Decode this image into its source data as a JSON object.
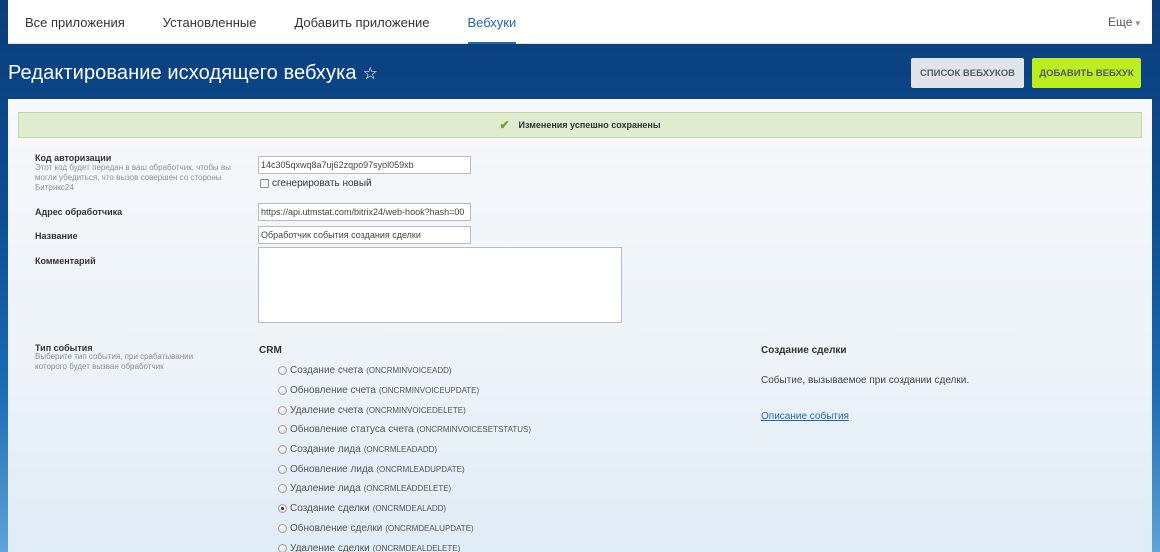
{
  "nav": {
    "tabs": [
      {
        "label": "Все приложения"
      },
      {
        "label": "Установленные"
      },
      {
        "label": "Добавить приложение"
      },
      {
        "label": "Вебхуки"
      }
    ],
    "more_label": "Еще",
    "more_caret": "▾"
  },
  "header": {
    "title": "Редактирование исходящего вебхука",
    "star": "☆",
    "list_button": "СПИСОК ВЕБХУКОВ",
    "add_button": "ДОБАВИТЬ ВЕБХУК"
  },
  "alert": {
    "check": "✔",
    "text": "Изменения успешно сохранены"
  },
  "form": {
    "auth_label": "Код авторизации",
    "auth_hint": "Этот код будет передан в ваш обработчик, чтобы вы могли убедиться, что вызов совершен со стороны Битрикс24",
    "auth_value": "14c305qxwq8a7uj62zqpo97syol059xb",
    "regen_label": "сгенерировать новый",
    "handler_label": "Адрес обработчика",
    "handler_value": "https://api.utmstat.com/bitrix24/web-hook?hash=00",
    "name_label": "Название",
    "name_value": "Обработчик события создания сделки",
    "comment_label": "Комментарий",
    "comment_value": "",
    "event_type_label": "Тип события",
    "event_type_hint": "Выберите тип события, при срабатывании которого будет вызван обработчик"
  },
  "events": {
    "group": "CRM",
    "items": [
      {
        "name": "Создание счета",
        "code": "(ONCRMINVOICEADD)",
        "checked": false
      },
      {
        "name": "Обновление счета",
        "code": "(ONCRMINVOICEUPDATE)",
        "checked": false
      },
      {
        "name": "Удаление счета",
        "code": "(ONCRMINVOICEDELETE)",
        "checked": false
      },
      {
        "name": "Обновление статуса счета",
        "code": "(ONCRMINVOICESETSTATUS)",
        "checked": false
      },
      {
        "name": "Создание лида",
        "code": "(ONCRMLEADADD)",
        "checked": false
      },
      {
        "name": "Обновление лида",
        "code": "(ONCRMLEADUPDATE)",
        "checked": false
      },
      {
        "name": "Удаление лида",
        "code": "(ONCRMLEADDELETE)",
        "checked": false
      },
      {
        "name": "Создание сделки",
        "code": "(ONCRMDEALADD)",
        "checked": true
      },
      {
        "name": "Обновление сделки",
        "code": "(ONCRMDEALUPDATE)",
        "checked": false
      },
      {
        "name": "Удаление сделки",
        "code": "(ONCRMDEALDELETE)",
        "checked": false
      }
    ]
  },
  "details": {
    "title": "Создание сделки",
    "description": "Событие, вызываемое при создании сделки.",
    "link": "Описание события"
  }
}
